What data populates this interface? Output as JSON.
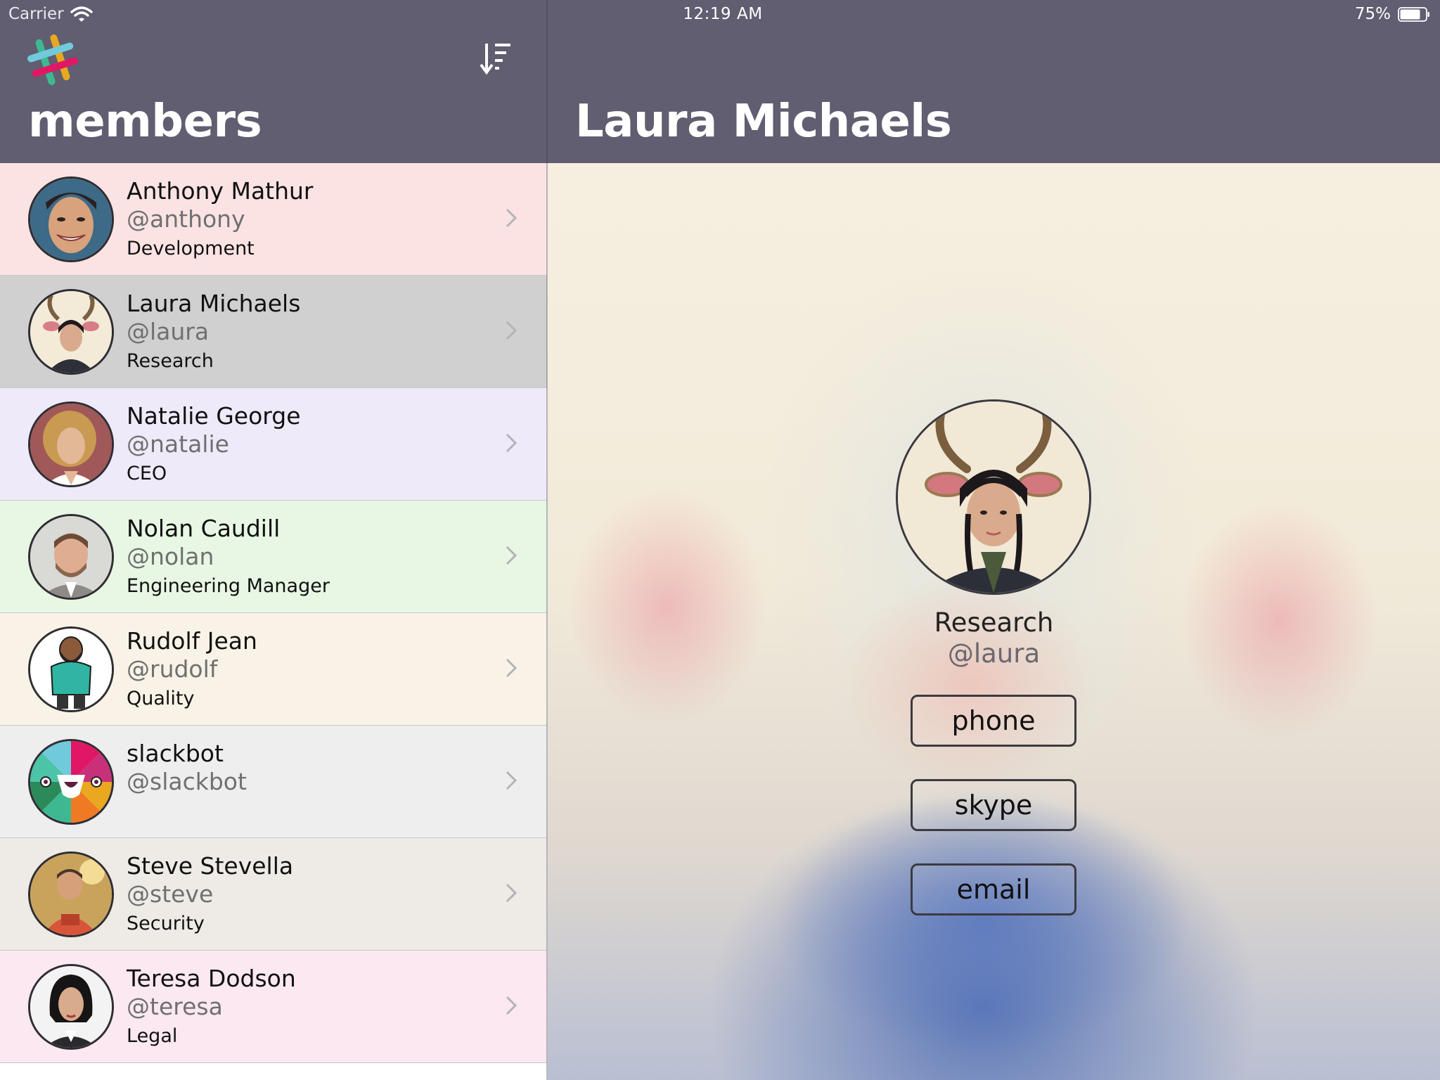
{
  "status_bar": {
    "carrier": "Carrier",
    "time": "12:19 AM",
    "battery": "75%"
  },
  "master": {
    "title": "members"
  },
  "detail": {
    "title": "Laura Michaels",
    "department": "Research",
    "handle": "@laura",
    "buttons": {
      "phone": "phone",
      "skype": "skype",
      "email": "email"
    }
  },
  "members": [
    {
      "name": "Anthony Mathur",
      "handle": "@anthony",
      "title": "Development",
      "row_color": "#fbe3e4"
    },
    {
      "name": "Laura Michaels",
      "handle": "@laura",
      "title": "Research",
      "row_color": "#d0d0d0",
      "selected": true
    },
    {
      "name": "Natalie George",
      "handle": "@natalie",
      "title": "CEO",
      "row_color": "#efeafa"
    },
    {
      "name": "Nolan Caudill",
      "handle": "@nolan",
      "title": "Engineering Manager",
      "row_color": "#e8f7e4"
    },
    {
      "name": "Rudolf Jean",
      "handle": "@rudolf",
      "title": "Quality",
      "row_color": "#f9f3e7"
    },
    {
      "name": "slackbot",
      "handle": "@slackbot",
      "title": "",
      "row_color": "#eeeeee"
    },
    {
      "name": "Steve Stevella",
      "handle": "@steve",
      "title": "Security",
      "row_color": "#eeebe6"
    },
    {
      "name": "Teresa Dodson",
      "handle": "@teresa",
      "title": "Legal",
      "row_color": "#fbe8f1"
    }
  ],
  "colors": {
    "header": "#605e70",
    "selected_row": "#d0d0d0"
  },
  "icons": [
    "wifi-icon",
    "battery-icon",
    "slack-logo-icon",
    "sort-icon",
    "chevron-right-icon"
  ]
}
